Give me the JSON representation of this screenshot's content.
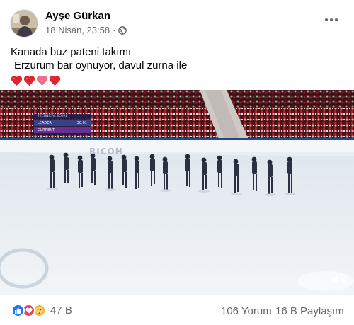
{
  "post": {
    "author": "Ayşe Gürkan",
    "timestamp": "18 Nisan, 23:58",
    "separator": "·",
    "privacy_icon": "globe-icon",
    "more_icon": "more-horizontal-icon",
    "text_line1": "Kanada buz pateni takımı",
    "text_line2": "Erzurum bar oynuyor, davul zurna ile",
    "emojis": [
      "red-heart",
      "red-heart",
      "sparkling-heart",
      "red-heart"
    ]
  },
  "video": {
    "scoreboard": {
      "title": "TECHNICAL SCORE",
      "leader_label": "LEADER",
      "leader_score": "30.01",
      "current_label": "CURRENT"
    },
    "sponsor": "RICOH",
    "mute_icon": "speaker-muted-icon"
  },
  "footer": {
    "reactions": [
      "like",
      "love",
      "care"
    ],
    "reaction_count": "47 B",
    "comments": "106 Yorum",
    "shares": "16 B Paylaşım"
  },
  "colors": {
    "like": "#1877f2",
    "love": "#f33e58",
    "care": "#f7b125",
    "secondary_text": "#65676b",
    "heart": "#e0242f"
  }
}
